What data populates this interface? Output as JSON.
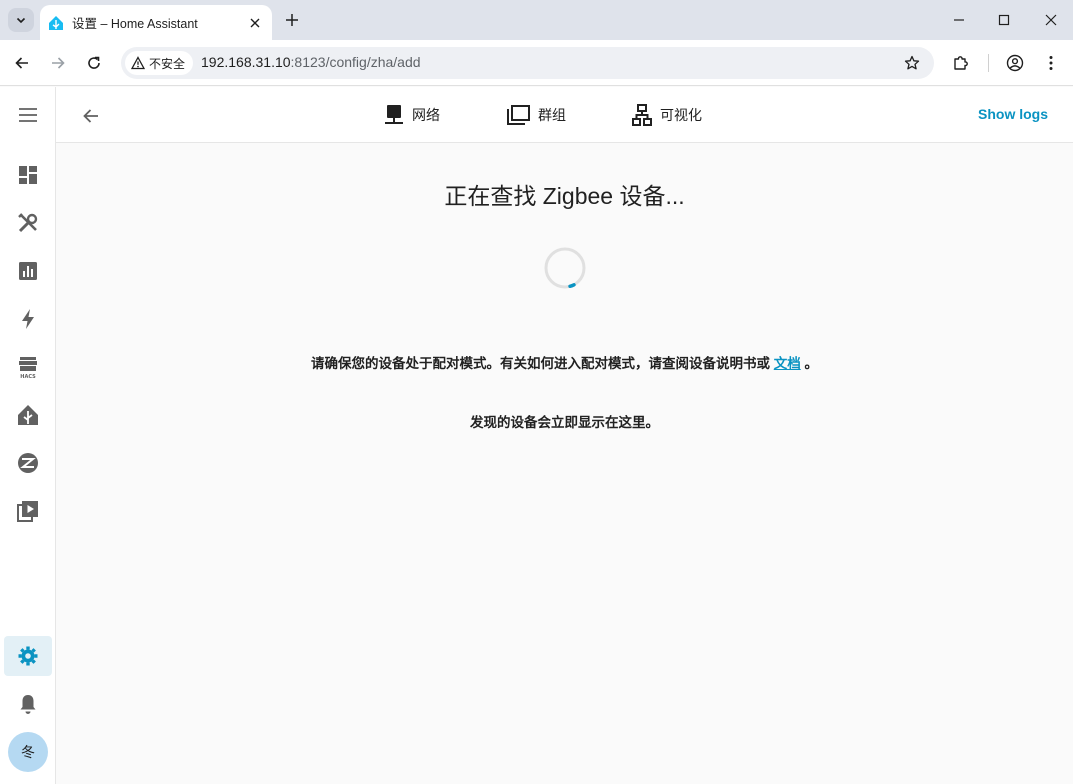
{
  "browser": {
    "tab_title": "设置 – Home Assistant",
    "security_label": "不安全",
    "url_host": "192.168.31.10",
    "url_path": ":8123/config/zha/add"
  },
  "header": {
    "tabs": [
      {
        "label": "网络",
        "icon": "network-icon"
      },
      {
        "label": "群组",
        "icon": "group-icon"
      },
      {
        "label": "可视化",
        "icon": "visualization-icon"
      }
    ],
    "show_logs": "Show logs"
  },
  "sidebar": {
    "items": [
      "menu-icon",
      "dashboard-icon",
      "tools-icon",
      "chart-icon",
      "energy-icon",
      "hacs-icon",
      "home-assistant-icon",
      "zigbee-icon",
      "media-icon",
      "settings-icon",
      "bell-icon"
    ],
    "avatar": "冬"
  },
  "main": {
    "title": "正在查找 Zigbee 设备...",
    "message_prefix": "请确保您的设备处于配对模式。有关如何进入配对模式，请查阅设备说明书或 ",
    "doc_link": "文档",
    "message_suffix": " 。",
    "message2": "发现的设备会立即显示在这里。"
  },
  "colors": {
    "accent": "#0a93c2",
    "sidebar_active_bg": "#e3f0f6",
    "avatar_bg": "#b5d9f2"
  }
}
